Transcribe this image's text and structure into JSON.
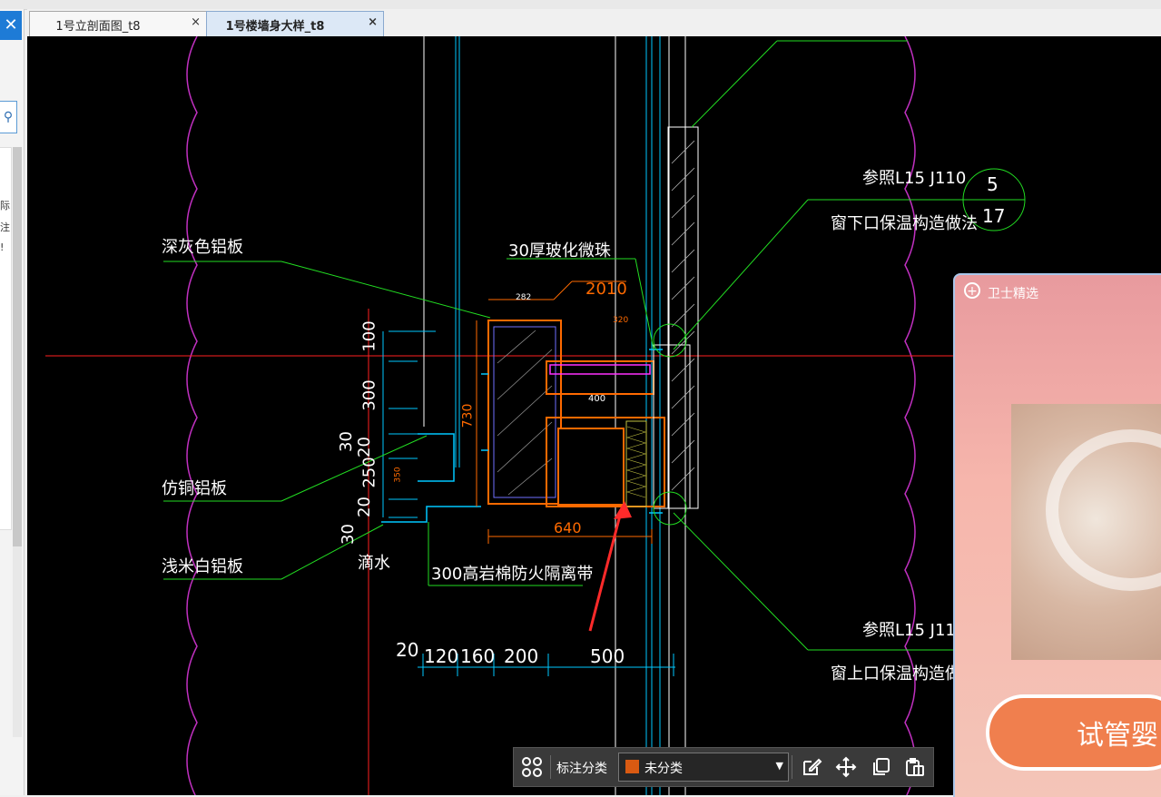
{
  "window": {
    "close_glyph": "✕"
  },
  "sidebar": {
    "search_glyph": "⚲",
    "truncated_chars": [
      "际",
      "注",
      "!"
    ]
  },
  "tabs": [
    {
      "label": "1号立剖面图_t8",
      "close": "×",
      "active": false
    },
    {
      "label": "1号楼墙身大样_t8",
      "close": "×",
      "active": true
    }
  ],
  "drawing": {
    "labels": {
      "dark_gray_panel": "深灰色铝板",
      "glass_bead_30": "30厚玻化微珠",
      "copper_panel": "仿铜铝板",
      "beige_panel": "浅米白铝板",
      "drip": "滴水",
      "rockwool_belt": "300高岩棉防火隔离带",
      "ref_top": "参照L15 J110",
      "ref_top_desc": "窗下口保温构造做法",
      "ref_bottom": "参照L15 J11",
      "ref_bottom_desc": "窗上口保温构造做"
    },
    "detail_callout": {
      "top": "5",
      "bottom": "17"
    },
    "dimensions": {
      "vertical": [
        "100",
        "300",
        "30",
        "20",
        "250",
        "20",
        "30"
      ],
      "vertical_small": [
        "730",
        "350"
      ],
      "horizontal_top": [
        "282",
        "2010",
        "320",
        "400"
      ],
      "horizontal_bottom": [
        "20",
        "120",
        "160",
        "200",
        "500"
      ],
      "width_640": "640"
    }
  },
  "ad": {
    "title": "卫士精选",
    "button_text": "试管婴"
  },
  "toolbar": {
    "grid_icon": "grid-icon",
    "label": "标注分类",
    "selected_category": "未分类",
    "category_color": "#d95a12",
    "dropdown_glyph": "▼"
  },
  "colors": {
    "cad_background": "#000000",
    "leader_green": "#00ff00",
    "cloud_magenta": "#c030c0",
    "dimension_cyan": "#00c8ff",
    "accent_orange": "#ff6a00",
    "annotation_arrow_red": "#ff2a2a"
  }
}
